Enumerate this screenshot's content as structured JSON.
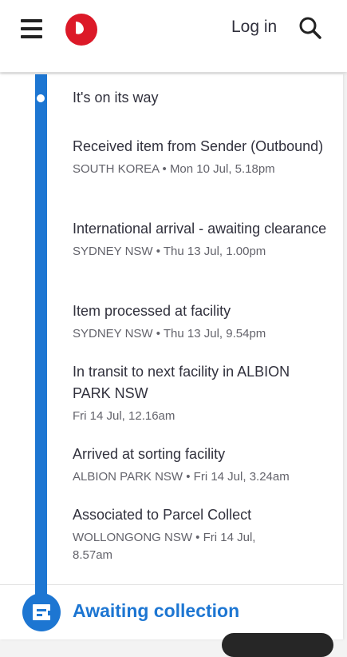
{
  "header": {
    "login_label": "Log in"
  },
  "colors": {
    "brand_red": "#dc1928",
    "accent_blue": "#1d76d2"
  },
  "icons": [
    "menu-icon",
    "australia-post-logo",
    "search-icon",
    "parcel-locker-icon"
  ],
  "timeline": {
    "status_title": "It's on its way",
    "events": [
      {
        "title": "Received item from Sender (Outbound)",
        "meta": "SOUTH KOREA • Mon 10 Jul, 5.18pm"
      },
      {
        "title": "International arrival - awaiting clearance",
        "meta": "SYDNEY NSW • Thu 13 Jul, 1.00pm"
      },
      {
        "title": "Item processed at facility",
        "meta": "SYDNEY NSW • Thu 13 Jul, 9.54pm"
      },
      {
        "title": "In transit to next facility in ALBION PARK NSW",
        "meta": "Fri 14 Jul, 12.16am"
      },
      {
        "title": "Arrived at sorting facility",
        "meta": "ALBION PARK NSW • Fri 14 Jul, 3.24am"
      },
      {
        "title": "Associated to Parcel Collect",
        "meta": "WOLLONGONG NSW • Fri 14 Jul, 8.57am"
      }
    ],
    "next_status": "Awaiting collection"
  }
}
